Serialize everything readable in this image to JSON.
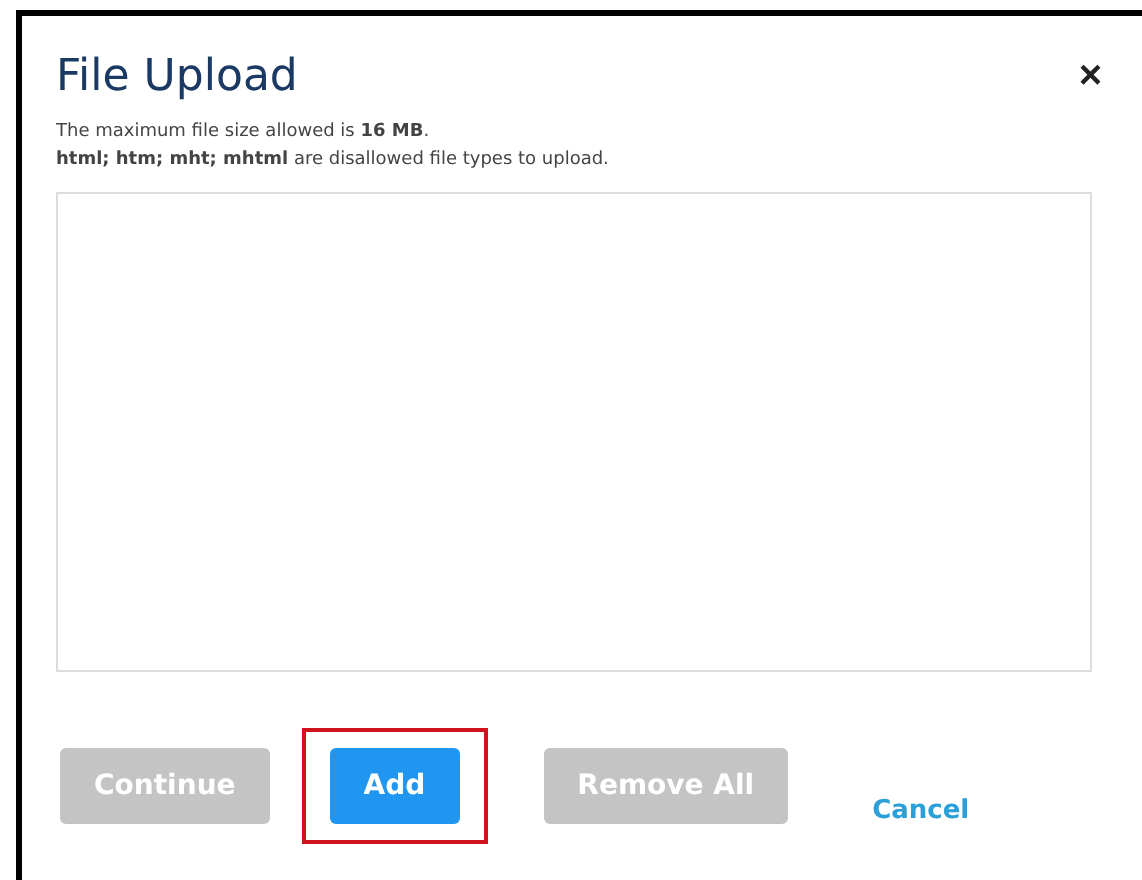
{
  "dialog": {
    "title": "File Upload",
    "close": "×"
  },
  "notes": [
    "The maximum file size allowed is **16 MB**.",
    "**html; htm; mht; mhtml** are disallowed file types to upload."
  ],
  "buttons": [
    {
      "label": "Continue",
      "kind": "button",
      "disabled": true,
      "highlighted": false
    },
    {
      "label": "Add",
      "kind": "button",
      "disabled": false,
      "highlighted": true
    },
    {
      "label": "Remove All",
      "kind": "button",
      "disabled": true,
      "highlighted": false
    },
    {
      "label": "Cancel",
      "kind": "link",
      "disabled": false,
      "highlighted": false
    }
  ]
}
